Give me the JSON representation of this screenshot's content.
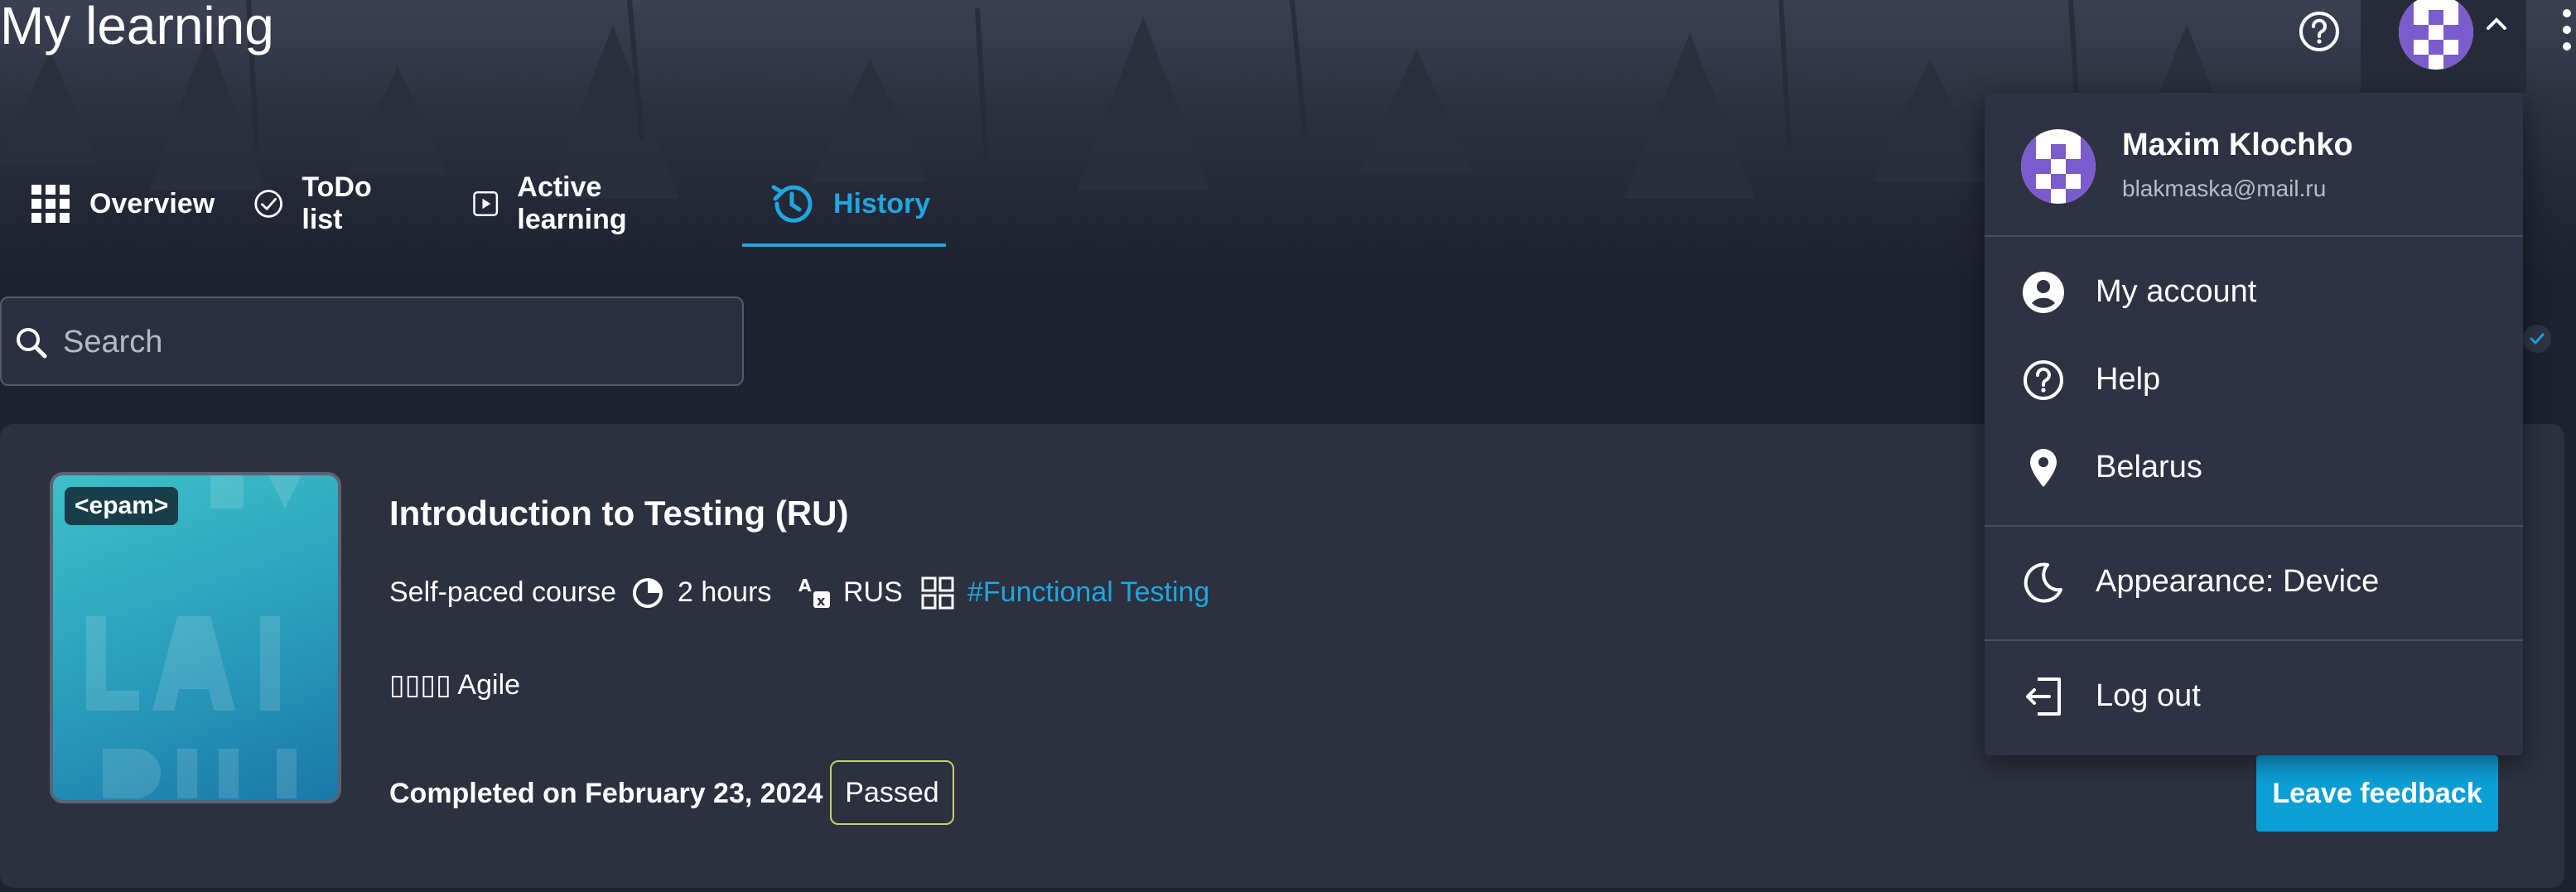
{
  "page": {
    "title": "My learning"
  },
  "header": {
    "help_icon": "question-circle-icon",
    "avatar_icon": "pixel-avatar-icon",
    "chevron_icon": "chevron-up-icon",
    "more_icon": "vertical-dots-icon"
  },
  "tabs": [
    {
      "label": "Overview",
      "icon": "grid-dots-icon",
      "active": false
    },
    {
      "label": "ToDo list",
      "icon": "check-circle-icon",
      "active": false
    },
    {
      "label": "Active learning",
      "icon": "play-square-icon",
      "active": false
    },
    {
      "label": "History",
      "icon": "history-clock-icon",
      "active": true
    }
  ],
  "search": {
    "placeholder": "Search",
    "value": ""
  },
  "course": {
    "thumbnail_badge": "<epam>",
    "title": "Introduction to Testing (RU)",
    "type": "Self-paced course",
    "duration": "2 hours",
    "language": "RUS",
    "tag": "#Functional Testing",
    "skill_prefix": "▯▯▯▯",
    "skill": "Agile",
    "completed": "Completed on February 23, 2024",
    "status": "Passed",
    "feedback_button": "Leave feedback"
  },
  "user_menu": {
    "name": "Maxim Klochko",
    "email": "blakmaska@mail.ru",
    "items": [
      {
        "label": "My account",
        "icon": "account-circle-icon"
      },
      {
        "label": "Help",
        "icon": "question-circle-icon"
      },
      {
        "label": "Belarus",
        "icon": "location-pin-icon"
      },
      {
        "label": "Appearance: Device",
        "icon": "moon-icon"
      },
      {
        "label": "Log out",
        "icon": "logout-icon"
      }
    ]
  },
  "colors": {
    "accent": "#1ea7e0",
    "button": "#0c9fd6",
    "background": "#1e2230",
    "card": "#2c303f",
    "menu": "#2e3242",
    "passed_border": "#c4d36a"
  }
}
